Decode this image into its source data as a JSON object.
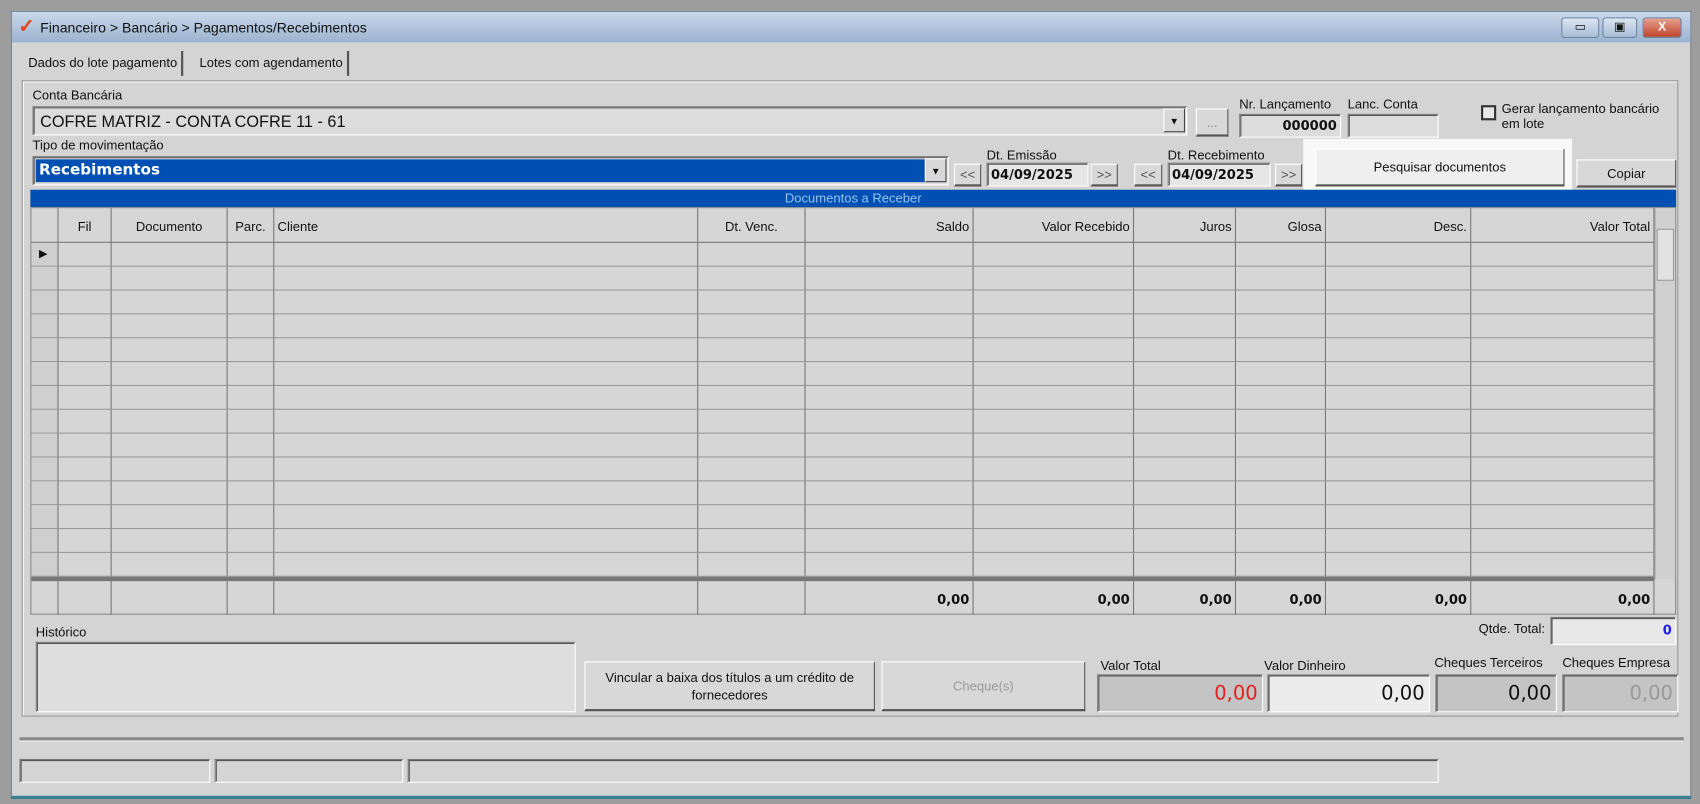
{
  "window": {
    "title": "Financeiro > Bancário > Pagamentos/Recebimentos",
    "minimize": "▭",
    "maximize": "▣",
    "close": "X"
  },
  "tabs": [
    {
      "label": "Dados do lote pagamento"
    },
    {
      "label": "Lotes com agendamento"
    }
  ],
  "form": {
    "conta_label": "Conta Bancária",
    "conta_value": "COFRE MATRIZ - CONTA COFRE 11 - 61",
    "ellipsis": "...",
    "nr_lancamento_label": "Nr. Lançamento",
    "nr_lancamento_value": "000000",
    "lanc_conta_label": "Lanc. Conta",
    "lanc_conta_value": "",
    "gerar_label_1": "Gerar lançamento bancário",
    "gerar_label_2": "em lote",
    "gerar_checked": false,
    "tipo_label": "Tipo de movimentação",
    "tipo_value": "Recebimentos",
    "prev": "<<",
    "next": ">>",
    "dt_emissao_label": "Dt. Emissão",
    "dt_emissao_value": "04/09/2025",
    "dt_recebimento_label": "Dt. Recebimento",
    "dt_recebimento_value": "04/09/2025",
    "pesquisar": "Pesquisar documentos",
    "copiar": "Copiar"
  },
  "grid": {
    "title": "Documentos a Receber",
    "columns": [
      "Fil",
      "Documento",
      "Parc.",
      "Cliente",
      "Dt. Venc.",
      "Saldo",
      "Valor Recebido",
      "Juros",
      "Glosa",
      "Desc.",
      "Valor Total"
    ],
    "totals": [
      "",
      "",
      "",
      "",
      "",
      "0,00",
      "0,00",
      "0,00",
      "0,00",
      "0,00",
      "0,00"
    ],
    "row_indicator": "▶"
  },
  "bottom": {
    "historico_label": "Histórico",
    "historico_value": "",
    "qtde_label": "Qtde. Total:",
    "qtde_value": "0",
    "vincular": "Vincular a baixa dos títulos a um crédito de fornecedores",
    "cheques": "Cheque(s)",
    "valor_total_label": "Valor Total",
    "valor_total": "0,00",
    "valor_dinheiro_label": "Valor Dinheiro",
    "valor_dinheiro": "0,00",
    "cheques_terceiros_label": "Cheques Terceiros",
    "cheques_terceiros": "0,00",
    "cheques_empresa_label": "Cheques Empresa",
    "cheques_empresa": "0,00"
  },
  "colors": {
    "selection": "#0050b4",
    "red": "#e02020",
    "blue": "#2020e0"
  }
}
